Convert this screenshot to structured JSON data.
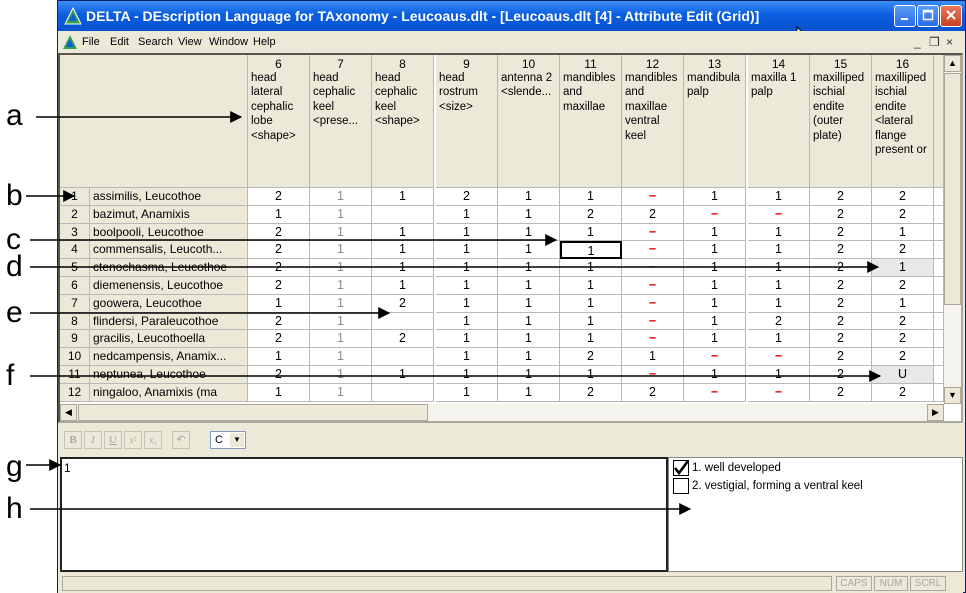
{
  "callouts": [
    "a",
    "b",
    "c",
    "d",
    "e",
    "f",
    "g",
    "h"
  ],
  "window": {
    "title": "DELTA - DEscription Language for TAxonomy - Leucoaus.dlt - [Leucoaus.dlt [4] - Attribute Edit (Grid)]",
    "minimize_icon": "minimize-icon",
    "maximize_icon": "maximize-icon",
    "close_icon": "close-icon"
  },
  "menu": {
    "items": [
      "File",
      "Edit",
      "Search",
      "View",
      "Window",
      "Help"
    ],
    "mdi_controls": [
      "_",
      "❐",
      "×"
    ]
  },
  "grid": {
    "columns": [
      {
        "num": "6",
        "desc": "head\nlateral\ncephalic\nlobe\n<shape>"
      },
      {
        "num": "7",
        "desc": "head\ncephalic\nkeel\n<prese..."
      },
      {
        "num": "8",
        "desc": "head\ncephalic\nkeel\n<shape>"
      },
      {
        "num": "9",
        "desc": "head\nrostrum\n<size>"
      },
      {
        "num": "10",
        "desc": "antenna 2\n<slende..."
      },
      {
        "num": "11",
        "desc": "mandibles\nand\nmaxillae"
      },
      {
        "num": "12",
        "desc": "mandibles\nand\nmaxillae\nventral\nkeel"
      },
      {
        "num": "13",
        "desc": "mandibula\npalp"
      },
      {
        "num": "14",
        "desc": "maxilla 1\npalp"
      },
      {
        "num": "15",
        "desc": "maxilliped\nischial\nendite\n(outer\nplate)"
      },
      {
        "num": "16",
        "desc": "maxilliped\nischial\nendite\n<lateral\nflange\npresent or"
      }
    ],
    "rows": [
      {
        "num": "1",
        "name": "assimilis, Leucothoe",
        "values": [
          "2",
          "1",
          "1",
          "2",
          "1",
          "1",
          "−",
          "1",
          "1",
          "2",
          "2"
        ]
      },
      {
        "num": "2",
        "name": "bazimut, Anamixis",
        "values": [
          "1",
          "1",
          "",
          "1",
          "1",
          "2",
          "2",
          "−",
          "−",
          "2",
          "2"
        ]
      },
      {
        "num": "3",
        "name": "boolpooli, Leucothoe",
        "values": [
          "2",
          "1",
          "1",
          "1",
          "1",
          "1",
          "−",
          "1",
          "1",
          "2",
          "1"
        ]
      },
      {
        "num": "4",
        "name": "commensalis, Leucoth...",
        "values": [
          "2",
          "1",
          "1",
          "1",
          "1",
          "1",
          "−",
          "1",
          "1",
          "2",
          "2"
        ]
      },
      {
        "num": "5",
        "name": "ctenochasma, Leucothoe",
        "values": [
          "2",
          "1",
          "1",
          "1",
          "1",
          "1",
          "−",
          "1",
          "1",
          "2",
          "1"
        ]
      },
      {
        "num": "6",
        "name": "diemenensis, Leucothoe",
        "values": [
          "2",
          "1",
          "1",
          "1",
          "1",
          "1",
          "−",
          "1",
          "1",
          "2",
          "2"
        ]
      },
      {
        "num": "7",
        "name": "goowera, Leucothoe",
        "values": [
          "1",
          "1",
          "2",
          "1",
          "1",
          "1",
          "−",
          "1",
          "1",
          "2",
          "1"
        ]
      },
      {
        "num": "8",
        "name": "flindersi, Paraleucothoe",
        "values": [
          "2",
          "1",
          "",
          "1",
          "1",
          "1",
          "−",
          "1",
          "2",
          "2",
          "2"
        ]
      },
      {
        "num": "9",
        "name": "gracilis, Leucothoella",
        "values": [
          "2",
          "1",
          "2",
          "1",
          "1",
          "1",
          "−",
          "1",
          "1",
          "2",
          "2"
        ]
      },
      {
        "num": "10",
        "name": "nedcampensis, Anamix...",
        "values": [
          "1",
          "1",
          "",
          "1",
          "1",
          "2",
          "1",
          "−",
          "−",
          "2",
          "2"
        ]
      },
      {
        "num": "11",
        "name": "neptunea, Leucothoe",
        "values": [
          "2",
          "1",
          "1",
          "1",
          "1",
          "1",
          "−",
          "1",
          "1",
          "2",
          "U"
        ]
      },
      {
        "num": "12",
        "name": "ningaloo, Anamixis (ma",
        "values": [
          "1",
          "1",
          "",
          "1",
          "1",
          "2",
          "2",
          "−",
          "−",
          "2",
          "2"
        ]
      }
    ]
  },
  "format_toolbar": {
    "buttons": [
      "B",
      "I",
      "U",
      "x²",
      "x₂",
      "↶"
    ],
    "combo_value": "C"
  },
  "editor": {
    "text": "1"
  },
  "states": [
    {
      "label": "1. well developed",
      "checked": true
    },
    {
      "label": "2. vestigial, forming a ventral keel",
      "checked": false
    }
  ],
  "statusbar": {
    "panels": [
      "CAPS",
      "NUM",
      "SCRL"
    ]
  }
}
